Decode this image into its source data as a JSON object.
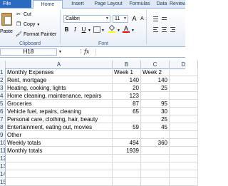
{
  "ribbon_tabs": [
    {
      "label": "File",
      "active": false
    },
    {
      "label": "Home",
      "active": true
    },
    {
      "label": "Insert",
      "active": false
    },
    {
      "label": "Page Layout",
      "active": false
    },
    {
      "label": "Formulas",
      "active": false
    },
    {
      "label": "Data",
      "active": false
    },
    {
      "label": "Review",
      "active": false
    }
  ],
  "clipboard": {
    "paste_label": "Paste",
    "cut_label": "Cut",
    "copy_label": "Copy",
    "format_painter_label": "Format Painter",
    "group_label": "Clipboard",
    "icons": [
      "paste-icon",
      "scissors-icon",
      "copy-icon",
      "paintbrush-icon"
    ]
  },
  "font": {
    "font_name": "Calibri",
    "font_size": "11",
    "bold": "B",
    "italic": "I",
    "underline": "U",
    "grow": "A",
    "shrink": "A",
    "font_color_glyph": "A",
    "group_label": "Font",
    "colors": {
      "highlight": "#ffff00",
      "font_color": "#ff0000"
    }
  },
  "formula_bar": {
    "name_box": "H18",
    "fx_label": "fx",
    "formula": ""
  },
  "columns": [
    "A",
    "B",
    "C",
    "D"
  ],
  "rows": [
    {
      "num": "1",
      "a": "Monthly Expenses",
      "b": "Week 1",
      "c": "Week 2",
      "d": ""
    },
    {
      "num": "2",
      "a": "Rent, mortgage",
      "b": "140",
      "c": "140",
      "d": ""
    },
    {
      "num": "3",
      "a": "Heating, cooking, lights",
      "b": "20",
      "c": "25",
      "d": ""
    },
    {
      "num": "4",
      "a": "Home cleaning, maintenance, repairs",
      "b": "123",
      "c": "",
      "d": ""
    },
    {
      "num": "5",
      "a": "Groceries",
      "b": "87",
      "c": "95",
      "d": ""
    },
    {
      "num": "6",
      "a": "Vehicle fuel, repairs, cleaning",
      "b": "65",
      "c": "30",
      "d": ""
    },
    {
      "num": "7",
      "a": "Personal care, clothing, hair, beauty",
      "b": "",
      "c": "25",
      "d": ""
    },
    {
      "num": "8",
      "a": "Entertainment, eating out, movies",
      "b": "59",
      "c": "45",
      "d": ""
    },
    {
      "num": "9",
      "a": "Other",
      "b": "",
      "c": "",
      "d": ""
    },
    {
      "num": "10",
      "a": "Weekly totals",
      "b": "494",
      "c": "360",
      "d": ""
    },
    {
      "num": "11",
      "a": "Monthly totals",
      "b": "1939",
      "c": "",
      "d": ""
    },
    {
      "num": "12",
      "a": "",
      "b": "",
      "c": "",
      "d": ""
    },
    {
      "num": "13",
      "a": "",
      "b": "",
      "c": "",
      "d": ""
    },
    {
      "num": "14",
      "a": "",
      "b": "",
      "c": "",
      "d": ""
    },
    {
      "num": "15",
      "a": "",
      "b": "",
      "c": "",
      "d": ""
    }
  ],
  "colors": {
    "file_tab": "#2a6ac1",
    "ribbon_border": "#8db2e3",
    "grid_line": "#d9d9d9",
    "header_bg": "#f3f6fb"
  }
}
